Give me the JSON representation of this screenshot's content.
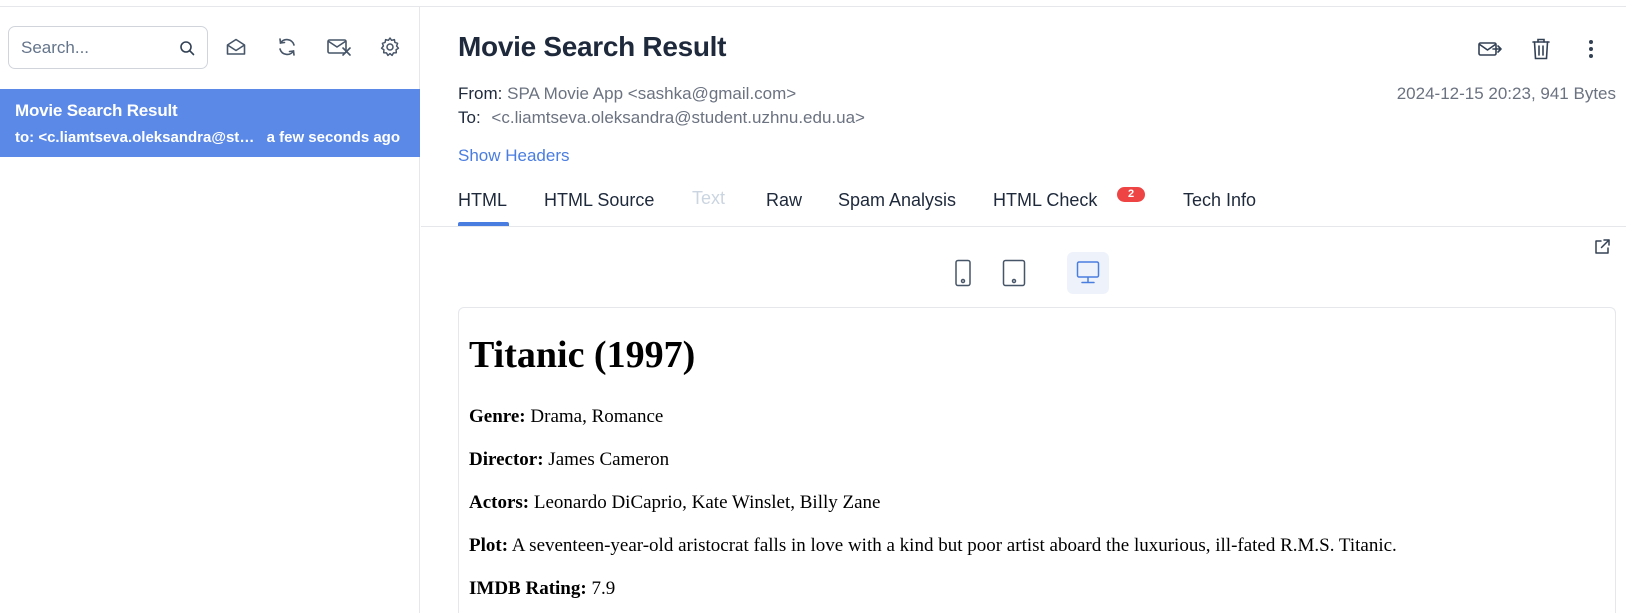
{
  "sidebar": {
    "search": {
      "placeholder": "Search...",
      "value": ""
    },
    "tools": [
      "mark-read-icon",
      "refresh-icon",
      "delete-all-icon",
      "settings-icon"
    ],
    "messages": [
      {
        "subject": "Movie Search Result",
        "to": "to: <c.liamtseva.oleksandra@student.uzhnu.edu.ua>",
        "time": "a few seconds ago"
      }
    ]
  },
  "message": {
    "title": "Movie Search Result",
    "from_label": "From:",
    "from_value": "SPA Movie App <sashka@gmail.com>",
    "to_label": "To:",
    "to_value": "<c.liamtseva.oleksandra@student.uzhnu.edu.ua>",
    "date_size": "2024-12-15 20:23, 941 Bytes",
    "show_headers": "Show Headers",
    "actions": [
      "forward-icon",
      "trash-icon",
      "more-vertical-icon"
    ]
  },
  "tabs": [
    {
      "label": "HTML",
      "state": "active"
    },
    {
      "label": "HTML Source",
      "state": "normal"
    },
    {
      "label": "Text",
      "state": "disabled"
    },
    {
      "label": "Raw",
      "state": "normal"
    },
    {
      "label": "Spam Analysis",
      "state": "normal"
    },
    {
      "label": "HTML Check",
      "state": "normal",
      "badge": "2"
    },
    {
      "label": "Tech Info",
      "state": "normal"
    }
  ],
  "devices": [
    "phone-icon",
    "tablet-icon",
    "desktop-icon"
  ],
  "active_device": "desktop",
  "preview": {
    "heading": "Titanic (1997)",
    "fields": [
      {
        "label": "Genre:",
        "value": "Drama, Romance"
      },
      {
        "label": "Director:",
        "value": "James Cameron"
      },
      {
        "label": "Actors:",
        "value": "Leonardo DiCaprio, Kate Winslet, Billy Zane"
      },
      {
        "label": "Plot:",
        "value": "A seventeen-year-old aristocrat falls in love with a kind but poor artist aboard the luxurious, ill-fated R.M.S. Titanic."
      },
      {
        "label": "IMDB Rating:",
        "value": "7.9"
      }
    ]
  },
  "colors": {
    "accent": "#4a7de0",
    "selected_row": "#5b89e8",
    "badge": "#ef4444",
    "text": "#1e293b",
    "muted": "#6b7280"
  }
}
